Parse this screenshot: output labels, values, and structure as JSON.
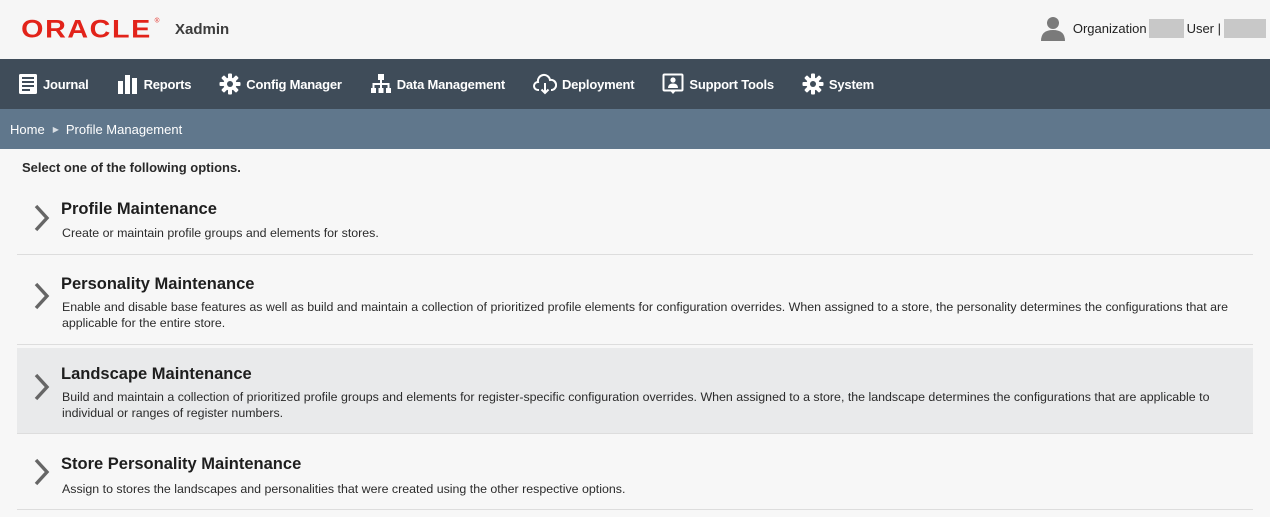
{
  "header": {
    "brand": "ORACLE",
    "brand_mark": "®",
    "app_name": "Xadmin",
    "org_label": "Organization",
    "user_label": "User |"
  },
  "nav": [
    {
      "label": "Journal",
      "icon": "journal-icon"
    },
    {
      "label": "Reports",
      "icon": "reports-icon"
    },
    {
      "label": "Config Manager",
      "icon": "gear-icon"
    },
    {
      "label": "Data Management",
      "icon": "hierarchy-icon"
    },
    {
      "label": "Deployment",
      "icon": "cloud-download-icon"
    },
    {
      "label": "Support Tools",
      "icon": "support-icon"
    },
    {
      "label": "System",
      "icon": "gear-icon"
    }
  ],
  "breadcrumb": {
    "home": "Home",
    "current": "Profile Management"
  },
  "main": {
    "instruction": "Select one of the following options.",
    "options": [
      {
        "title": "Profile Maintenance",
        "description": "Create or maintain profile groups and elements for stores."
      },
      {
        "title": "Personality Maintenance",
        "description": "Enable and disable base features as well as build and maintain a collection of prioritized profile elements for configuration overrides. When assigned to a store, the personality determines the configurations that are applicable for the entire store."
      },
      {
        "title": "Landscape Maintenance",
        "description": "Build and maintain a collection of prioritized profile groups and elements for register-specific configuration overrides. When assigned to a store, the landscape determines the configurations that are applicable to individual or ranges of register numbers."
      },
      {
        "title": "Store Personality Maintenance",
        "description": "Assign to stores the landscapes and personalities that were created using the other respective options."
      }
    ]
  },
  "colors": {
    "brand_red": "#e2231a",
    "nav_bg": "#3f4c59",
    "breadcrumb_bg": "#60778c",
    "selected_row_bg": "#e9eaeb"
  }
}
